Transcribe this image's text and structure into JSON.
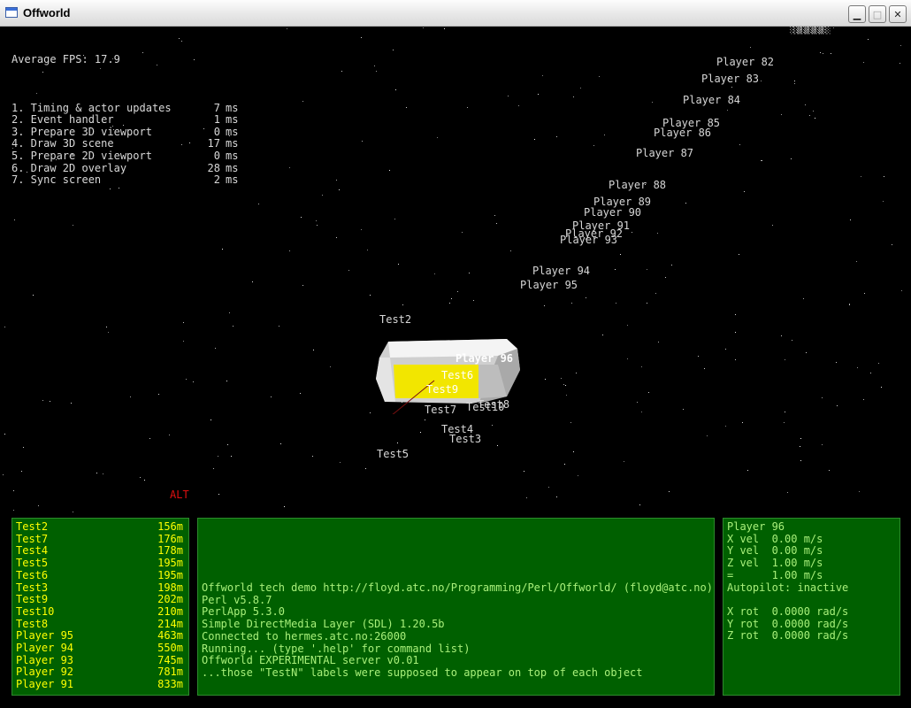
{
  "window": {
    "title": "Offworld"
  },
  "perf": {
    "fps_label": "Average FPS: 17.9",
    "rows": [
      {
        "label": "1. Timing & actor updates",
        "value": "7",
        "unit": "ms"
      },
      {
        "label": "2. Event handler",
        "value": "1",
        "unit": "ms"
      },
      {
        "label": "3. Prepare 3D viewport",
        "value": "0",
        "unit": "ms"
      },
      {
        "label": "4. Draw 3D scene",
        "value": "17",
        "unit": "ms"
      },
      {
        "label": "5. Prepare 2D viewport",
        "value": "0",
        "unit": "ms"
      },
      {
        "label": "6. Draw 2D overlay",
        "value": "28",
        "unit": "ms"
      },
      {
        "label": "7. Sync screen",
        "value": "2",
        "unit": "ms"
      }
    ]
  },
  "scene_labels": {
    "p82": "Player 82",
    "p83": "Player 83",
    "p84": "Player 84",
    "p85": "Player 85",
    "p86": "Player 86",
    "p87": "Player 87",
    "p88": "Player 88",
    "p89": "Player 89",
    "p90": "Player 90",
    "p91": "Player 91",
    "p92": "Player 92",
    "p93": "Player 93",
    "p94": "Player 94",
    "p95": "Player 95",
    "p96": "Player 96",
    "t2": "Test2",
    "t6": "Test6",
    "t9": "Test9",
    "t7": "Test7",
    "t10": "Test10",
    "t8": "Test8",
    "t4": "Test4",
    "t3": "Test3",
    "t5": "Test5",
    "alt": "ALT"
  },
  "targets": [
    {
      "name": "Test2",
      "dist": "156m"
    },
    {
      "name": "Test7",
      "dist": "176m"
    },
    {
      "name": "Test4",
      "dist": "178m"
    },
    {
      "name": "Test5",
      "dist": "195m"
    },
    {
      "name": "Test6",
      "dist": "195m"
    },
    {
      "name": "Test3",
      "dist": "198m"
    },
    {
      "name": "Test9",
      "dist": "202m"
    },
    {
      "name": "Test10",
      "dist": "210m"
    },
    {
      "name": "Test8",
      "dist": "214m"
    },
    {
      "name": "Player 95",
      "dist": "463m"
    },
    {
      "name": "Player 94",
      "dist": "550m"
    },
    {
      "name": "Player 93",
      "dist": "745m"
    },
    {
      "name": "Player 92",
      "dist": "781m"
    },
    {
      "name": "Player 91",
      "dist": "833m"
    }
  ],
  "console": [
    "Offworld tech demo http://floyd.atc.no/Programming/Perl/Offworld/ (floyd@atc.no)",
    "Perl v5.8.7",
    "PerlApp 5.3.0",
    "Simple DirectMedia Layer (SDL) 1.20.5b",
    "Connected to hermes.atc.no:26000",
    "Running... (type '.help' for command list)",
    "Offworld EXPERIMENTAL server v0.01",
    "...those \"TestN\" labels were supposed to appear on top of each object"
  ],
  "status": {
    "player": "Player 96",
    "x_vel": "X vel  0.00 m/s",
    "y_vel": "Y vel  0.00 m/s",
    "z_vel": "Z vel  1.00 m/s",
    "total_vel": "=      1.00 m/s",
    "autopilot": "Autopilot: inactive",
    "x_rot": "X rot  0.0000 rad/s",
    "y_rot": "Y rot  0.0000 rad/s",
    "z_rot": "Z rot  0.0000 rad/s"
  },
  "colors": {
    "hud_panel": "#006000",
    "hud_yellow": "#ffff00",
    "hud_green_text": "#a8f07a",
    "alt_red": "#e01010"
  },
  "icons": [
    "app-window-icon",
    "minimize-icon",
    "maximize-icon",
    "close-icon"
  ]
}
